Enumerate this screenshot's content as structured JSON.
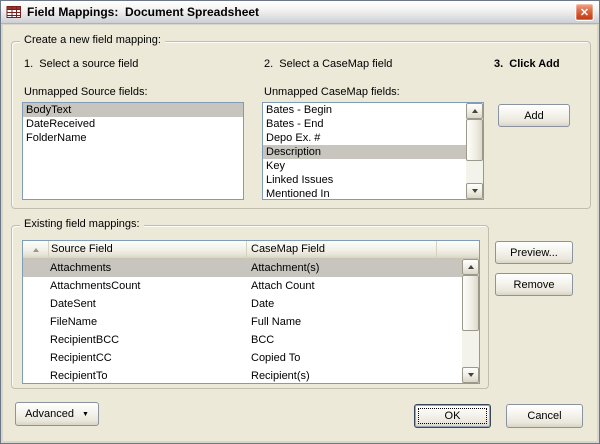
{
  "window": {
    "title": "Field Mappings:  Document Spreadsheet"
  },
  "icons": {
    "close": "✕",
    "dropdown": "▼"
  },
  "create": {
    "title": "Create a new field mapping:",
    "step1": "1.  Select a source field",
    "step2": "2.  Select a CaseMap field",
    "step3": "3.  Click Add",
    "source_label": "Unmapped Source fields:",
    "source_items": [
      "BodyText",
      "DateReceived",
      "FolderName"
    ],
    "source_selected_index": 0,
    "casemap_label": "Unmapped CaseMap fields:",
    "casemap_items": [
      "Bates - Begin",
      "Bates - End",
      "Depo Ex. #",
      "Description",
      "Key",
      "Linked Issues",
      "Mentioned In"
    ],
    "casemap_selected_index": 3,
    "add_label": "Add"
  },
  "existing": {
    "title": "Existing field mappings:",
    "columns": [
      "Source Field",
      "CaseMap Field"
    ],
    "rows": [
      [
        "Attachments",
        "Attachment(s)"
      ],
      [
        "AttachmentsCount",
        "Attach Count"
      ],
      [
        "DateSent",
        "Date"
      ],
      [
        "FileName",
        "Full Name"
      ],
      [
        "RecipientBCC",
        "BCC"
      ],
      [
        "RecipientCC",
        "Copied To"
      ],
      [
        "RecipientTo",
        "Recipient(s)"
      ]
    ],
    "selected_row_index": 0,
    "preview_label": "Preview...",
    "remove_label": "Remove"
  },
  "footer": {
    "advanced_label": "Advanced",
    "ok_label": "OK",
    "cancel_label": "Cancel"
  },
  "colors": {
    "dialog_bg": "#ECE9D8",
    "selection_inactive": "#C8C5BE",
    "close_button_red": "#C8431C",
    "listbox_border": "#7F9DB9"
  }
}
